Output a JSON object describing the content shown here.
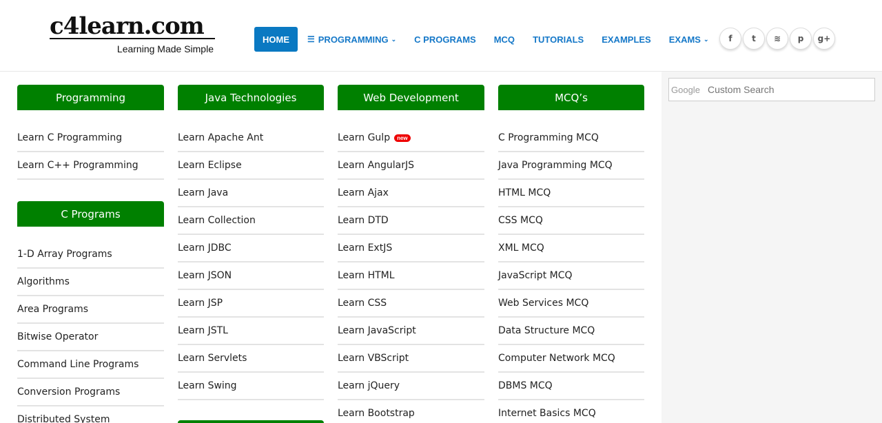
{
  "logo": {
    "main": "c4learn.com",
    "tagline": "Learning Made Simple"
  },
  "nav": [
    {
      "label": "HOME",
      "icon": "",
      "caret": ""
    },
    {
      "label": "PROGRAMMING",
      "icon": "list-icon",
      "caret": "⌄"
    },
    {
      "label": "C PROGRAMS",
      "icon": "",
      "caret": ""
    },
    {
      "label": "MCQ",
      "icon": "",
      "caret": ""
    },
    {
      "label": "TUTORIALS",
      "icon": "",
      "caret": ""
    },
    {
      "label": "EXAMPLES",
      "icon": "",
      "caret": ""
    },
    {
      "label": "EXAMS",
      "icon": "",
      "caret": "⌄"
    }
  ],
  "social": [
    {
      "name": "facebook-icon",
      "glyph": "f"
    },
    {
      "name": "twitter-icon",
      "glyph": "t"
    },
    {
      "name": "rss-icon",
      "glyph": "≋"
    },
    {
      "name": "pinterest-icon",
      "glyph": "p"
    },
    {
      "name": "google-plus-icon",
      "glyph": "g+"
    }
  ],
  "columns": {
    "programming": {
      "title": "Programming",
      "items": [
        "Learn C Programming",
        "Learn C++ Programming"
      ]
    },
    "c_programs": {
      "title": "C Programs",
      "items": [
        "1-D Array Programs",
        "Algorithms",
        "Area Programs",
        "Bitwise Operator",
        "Command Line Programs",
        "Conversion Programs",
        "Distributed System"
      ]
    },
    "java": {
      "title": "Java Technologies",
      "items": [
        "Learn Apache Ant",
        "Learn Eclipse",
        "Learn Java",
        "Learn Collection",
        "Learn JDBC",
        "Learn JSON",
        "Learn JSP",
        "Learn JSTL",
        "Learn Servlets",
        "Learn Swing"
      ]
    },
    "web": {
      "title": "Web Development",
      "items": [
        "Learn Gulp",
        "Learn AngularJS",
        "Learn Ajax",
        "Learn DTD",
        "Learn ExtJS",
        "Learn HTML",
        "Learn CSS",
        "Learn JavaScript",
        "Learn VBScript",
        "Learn jQuery",
        "Learn Bootstrap"
      ],
      "new_badge": "new"
    },
    "mcq": {
      "title": "MCQ’s",
      "items": [
        "C Programming MCQ",
        "Java Programming MCQ",
        "HTML MCQ",
        "CSS MCQ",
        "XML MCQ",
        "JavaScript MCQ",
        "Web Services MCQ",
        "Data Structure MCQ",
        "Computer Network MCQ",
        "DBMS MCQ",
        "Internet Basics MCQ"
      ]
    }
  },
  "search": {
    "brand": "Google",
    "placeholder": "Custom Search"
  },
  "colors": {
    "accent": "#0a79c2",
    "header_green": "#008000",
    "nav_text": "#1578c8"
  }
}
